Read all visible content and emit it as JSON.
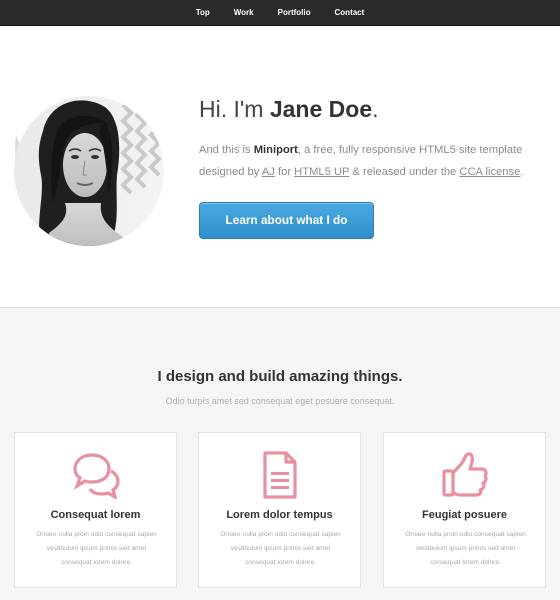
{
  "nav": {
    "items": [
      "Top",
      "Work",
      "Portfolio",
      "Contact"
    ]
  },
  "hero": {
    "greeting": "Hi. I'm ",
    "name": "Jane Doe",
    "name_suffix": ".",
    "desc_part1": "And this is ",
    "brand": "Miniport",
    "desc_part2": ", a free, fully responsive HTML5 site template designed by ",
    "link_author": "AJ",
    "desc_part3": " for ",
    "link_html5up": "HTML5 UP",
    "desc_part4": " & released under the ",
    "link_license": "CCA license",
    "desc_part5": ".",
    "cta_label": "Learn about what I do"
  },
  "work": {
    "title": "I design and build amazing things.",
    "subtitle": "Odio turpis amet sed consequat eget posuere consequat.",
    "cards": [
      {
        "icon": "speech-bubbles-icon",
        "title": "Consequat lorem",
        "text": "Ornare nulla proin odio consequat sapien vestibulum ipsum primis sed amet consequat lorem dolore."
      },
      {
        "icon": "document-icon",
        "title": "Lorem dolor tempus",
        "text": "Ornare nulla proin odio consequat sapien vestibulum ipsum primis sed amet consequat lorem dolore."
      },
      {
        "icon": "thumbs-up-icon",
        "title": "Feugiat posuere",
        "text": "Ornare nulla proin odio consequat sapien vestibulum ipsum primis sed amet consequat lorem dolore."
      }
    ]
  },
  "colors": {
    "navbar": "#2a2a2b",
    "accent_blue": "#3a9ad6",
    "icon_pink": "#e88fa0",
    "page_bg": "#f5f5f5"
  }
}
